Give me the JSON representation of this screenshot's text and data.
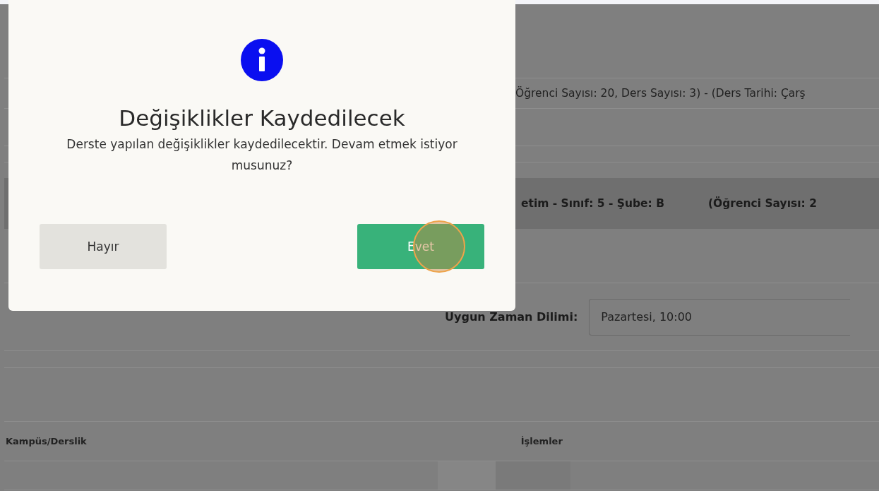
{
  "background": {
    "lesson_info": "Öğrenci Sayısı: 20, Ders Sayısı: 3) - (Ders Tarihi: Çarş",
    "group_header": {
      "class_info": "etim - Sınıf: 5 - Şube: B",
      "student_count": "(Öğrenci Sayısı: 2"
    },
    "time_slot": {
      "label": "Uygun Zaman Dilimi:",
      "value": "Pazartesi, 10:00"
    },
    "table": {
      "columns": [
        "Kampüs/Derslik",
        "İşlemler"
      ]
    }
  },
  "dialog": {
    "title": "Değişiklikler Kaydedilecek",
    "message": "Derste yapılan değişiklikler kaydedilecektir. Devam etmek istiyor musunuz?",
    "buttons": [
      {
        "label": "Hayır",
        "kind": "cancel"
      },
      {
        "label": "Evet",
        "kind": "confirm"
      }
    ]
  }
}
